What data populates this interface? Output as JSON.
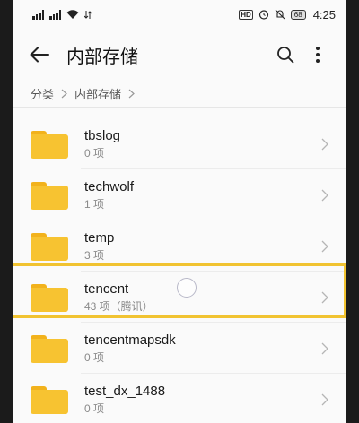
{
  "status_bar": {
    "battery": "68",
    "time": "4:25",
    "hd_label": "HD"
  },
  "app_bar": {
    "title": "内部存储"
  },
  "breadcrumb": {
    "items": [
      "分类",
      "内部存储"
    ]
  },
  "files": [
    {
      "name": "tbslog",
      "meta": "0 项"
    },
    {
      "name": "techwolf",
      "meta": "1 项"
    },
    {
      "name": "temp",
      "meta": "3 项"
    },
    {
      "name": "tencent",
      "meta": "43 项（腾讯）"
    },
    {
      "name": "tencentmapsdk",
      "meta": "0 项"
    },
    {
      "name": "test_dx_1488",
      "meta": "0 项"
    }
  ],
  "colors": {
    "folder": "#f7c331",
    "highlight": "#f1c331"
  }
}
